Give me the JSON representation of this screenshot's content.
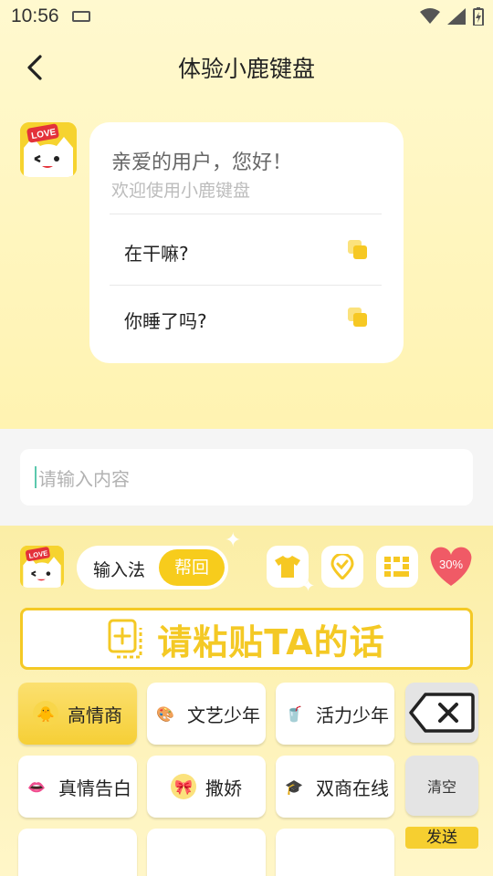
{
  "status": {
    "time": "10:56"
  },
  "header": {
    "title": "体验小鹿键盘"
  },
  "chat": {
    "greeting": "亲爱的用户，您好！",
    "subtitle": "欢迎使用小鹿键盘",
    "phrases": [
      "在干嘛?",
      "你睡了吗?"
    ]
  },
  "input": {
    "placeholder": "请输入内容"
  },
  "keyboard": {
    "mode_ime": "输入法",
    "mode_help": "帮回",
    "badge_percent": "30%",
    "paste_banner": "请粘贴TA的话",
    "clear_label": "清空",
    "send_label": "发送",
    "keys": [
      {
        "label": "高情商",
        "icon": "chick-emoji"
      },
      {
        "label": "文艺少年",
        "icon": "palette-emoji"
      },
      {
        "label": "活力少年",
        "icon": "drink-can-emoji"
      },
      {
        "label": "真情告白",
        "icon": "lips-emoji"
      },
      {
        "label": "撒娇",
        "icon": "bow-face-emoji"
      },
      {
        "label": "双商在线",
        "icon": "graduation-cap-emoji"
      }
    ],
    "colors": {
      "accent": "#f6cf30",
      "active_key": "#f8d848"
    }
  }
}
